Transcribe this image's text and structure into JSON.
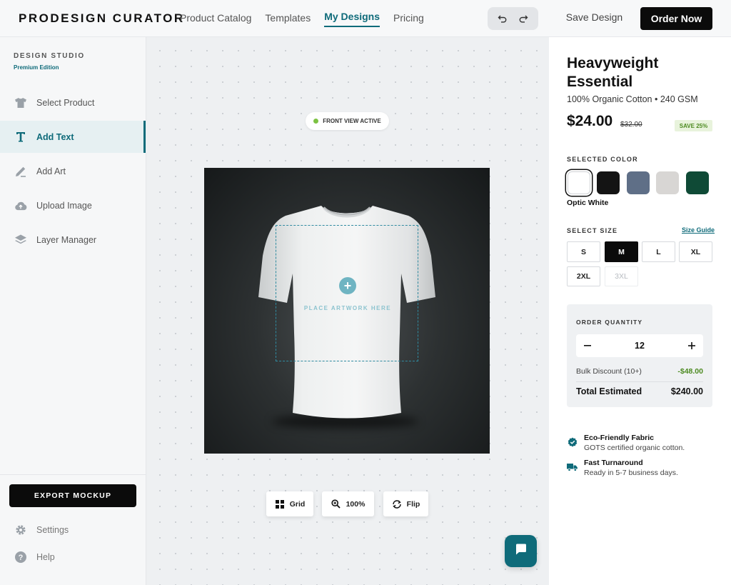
{
  "header": {
    "brand": "PRODESIGN CURATOR",
    "nav": [
      "Product Catalog",
      "Templates",
      "My Designs",
      "Pricing"
    ],
    "active_nav": "My Designs",
    "save_label": "Save Design",
    "order_label": "Order Now"
  },
  "sidebar": {
    "title": "DESIGN STUDIO",
    "subtitle": "Premium Edition",
    "items": [
      {
        "label": "Select Product",
        "icon": "shirt-icon"
      },
      {
        "label": "Add Text",
        "icon": "text-icon"
      },
      {
        "label": "Add Art",
        "icon": "brush-icon"
      },
      {
        "label": "Upload Image",
        "icon": "cloud-upload-icon"
      },
      {
        "label": "Layer Manager",
        "icon": "layers-icon"
      }
    ],
    "active_item": "Add Text",
    "export_label": "EXPORT MOCKUP",
    "footer": [
      {
        "label": "Settings",
        "icon": "gear-icon"
      },
      {
        "label": "Help",
        "icon": "help-icon"
      }
    ]
  },
  "canvas": {
    "view_badge": "FRONT VIEW ACTIVE",
    "print_area_label": "PLACE ARTWORK HERE",
    "tools": [
      {
        "label": "Grid",
        "icon": "grid-icon"
      },
      {
        "label": "100%",
        "icon": "zoom-icon"
      },
      {
        "label": "Flip",
        "icon": "flip-icon"
      }
    ],
    "accent": "#0f6b7a"
  },
  "product": {
    "name": "Heavyweight Essential",
    "material": "100% Organic Cotton • 240 GSM",
    "price": "$24.00",
    "old_price": "$32.00",
    "save_badge": "SAVE 25%",
    "color_label": "SELECTED COLOR",
    "colors": [
      "#ffffff",
      "#141414",
      "#5f6f87",
      "#d8d6d4",
      "#0f4a36"
    ],
    "selected_color_name": "Optic White",
    "size_label": "SELECT SIZE",
    "size_guide": "Size Guide",
    "sizes": [
      "S",
      "M",
      "L",
      "XL",
      "2XL",
      "3XL"
    ],
    "selected_size": "M",
    "disabled_size": "3XL"
  },
  "order": {
    "label": "ORDER QUANTITY",
    "quantity": "12",
    "bulk_label": "Bulk Discount (10+)",
    "bulk_value": "-$48.00",
    "total_label": "Total Estimated",
    "total_value": "$240.00"
  },
  "features": [
    {
      "title": "Eco-Friendly Fabric",
      "desc": "GOTS certified organic cotton.",
      "icon": "verified-badge-icon"
    },
    {
      "title": "Fast Turnaround",
      "desc": "Ready in 5-7 business days.",
      "icon": "truck-icon"
    }
  ]
}
